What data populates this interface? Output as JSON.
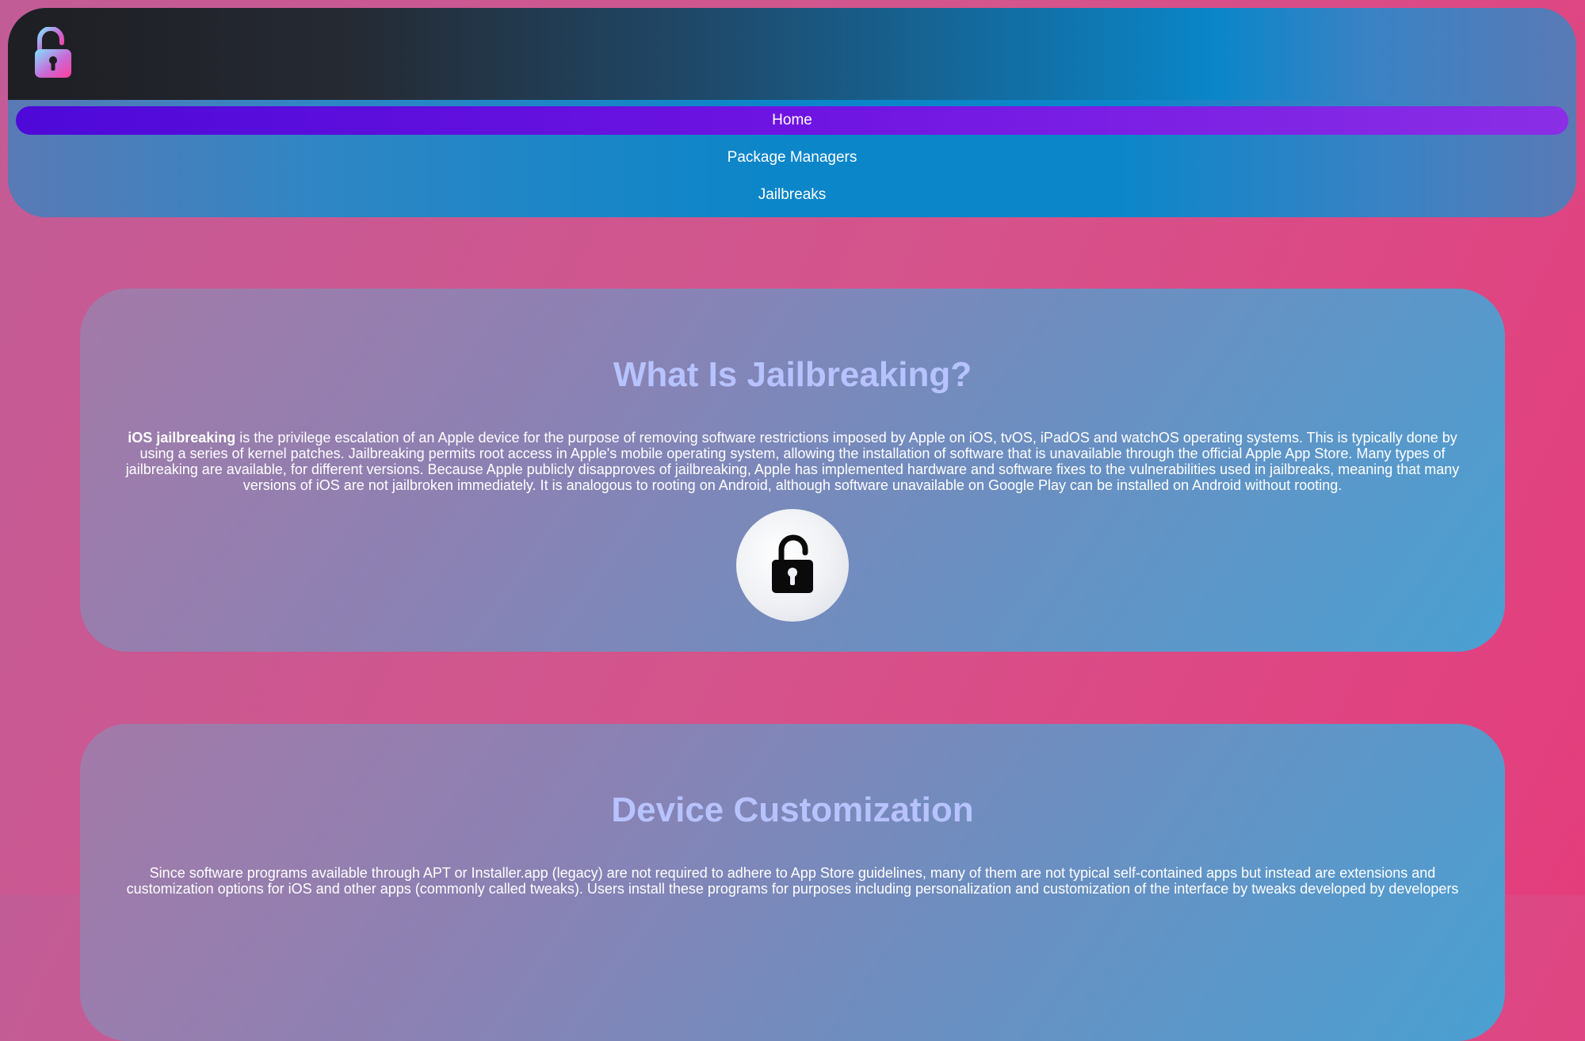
{
  "header": {
    "logo_icon": "unlocked-padlock-icon",
    "nav_items": [
      {
        "label": "Home",
        "active": true
      },
      {
        "label": "Package Managers",
        "active": false
      },
      {
        "label": "Jailbreaks",
        "active": false
      }
    ]
  },
  "sections": [
    {
      "title": "What Is Jailbreaking?",
      "lead_bold": "iOS jailbreaking",
      "body": " is the privilege escalation of an Apple device for the purpose of removing software restrictions imposed by Apple on iOS, tvOS, iPadOS and watchOS operating systems. This is typically done by using a series of kernel patches. Jailbreaking permits root access in Apple's mobile operating system, allowing the installation of software that is unavailable through the official Apple App Store. Many types of jailbreaking are available, for different versions. Because Apple publicly disapproves of jailbreaking, Apple has implemented hardware and software fixes to the vulnerabilities used in jailbreaks, meaning that many versions of iOS are not jailbroken immediately. It is analogous to rooting on Android, although software unavailable on Google Play can be installed on Android without rooting.",
      "image_icon": "unlocked-padlock-icon"
    },
    {
      "title": "Device Customization",
      "body": "Since software programs available through APT or Installer.app (legacy) are not required to adhere to App Store guidelines, many of them are not typical self-contained apps but instead are extensions and customization options for iOS and other apps (commonly called tweaks). Users install these programs for purposes including personalization and customization of the interface by tweaks developed by developers"
    }
  ],
  "colors": {
    "title_color": "#b7c3ff",
    "nav_active": "#6e14e2",
    "page_background": "#d4548c"
  }
}
